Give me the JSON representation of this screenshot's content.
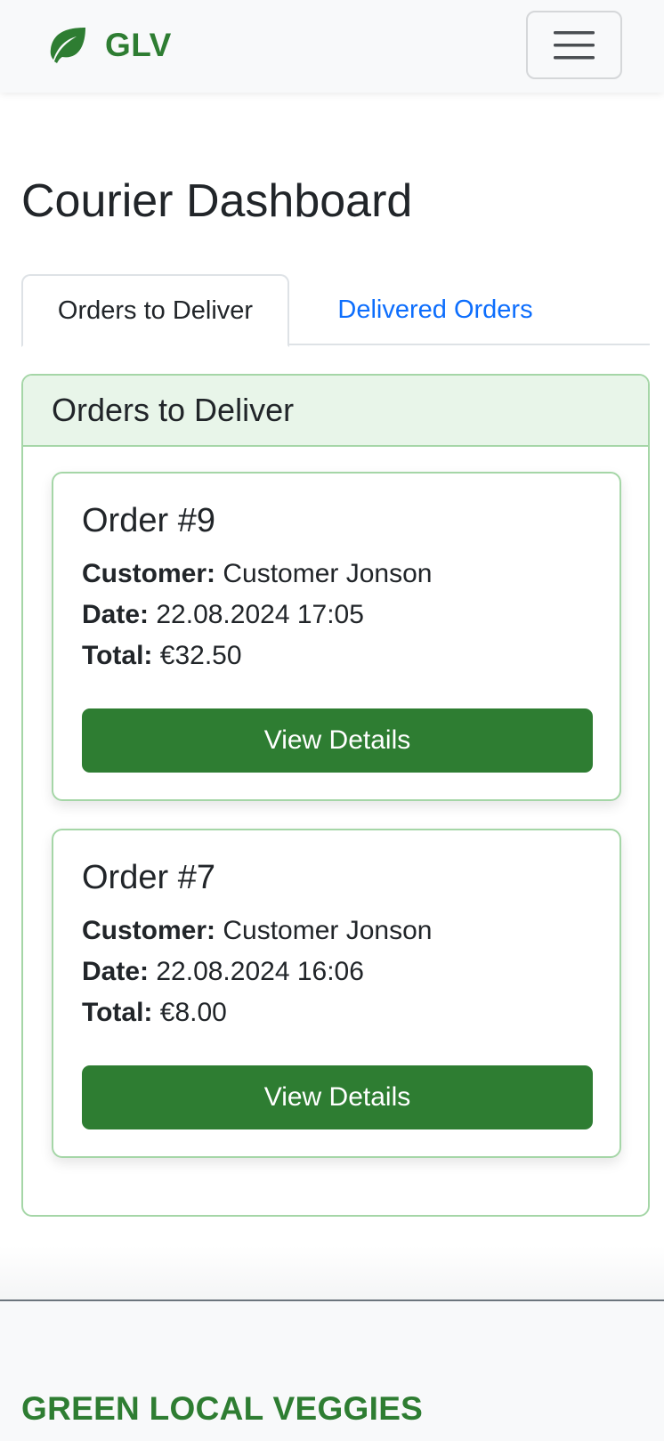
{
  "navbar": {
    "brand_text": "GLV",
    "brand_icon": "leaf-icon",
    "toggler_icon": "hamburger-icon"
  },
  "page": {
    "title": "Courier Dashboard"
  },
  "tabs": [
    {
      "label": "Orders to Deliver",
      "active": true
    },
    {
      "label": "Delivered Orders",
      "active": false
    }
  ],
  "panel": {
    "header": "Orders to Deliver",
    "orders": [
      {
        "title": "Order #9",
        "customer_label": "Customer:",
        "customer": "Customer Jonson",
        "date_label": "Date:",
        "date": "22.08.2024 17:05",
        "total_label": "Total:",
        "total": "€32.50",
        "button": "View Details"
      },
      {
        "title": "Order #7",
        "customer_label": "Customer:",
        "customer": "Customer Jonson",
        "date_label": "Date:",
        "date": "22.08.2024 16:06",
        "total_label": "Total:",
        "total": "€8.00",
        "button": "View Details"
      }
    ]
  },
  "footer": {
    "title": "GREEN LOCAL VEGGIES"
  },
  "colors": {
    "brand_green": "#2e7d32",
    "link_blue": "#0d6efd",
    "card_border": "#a5d6a7",
    "panel_header_bg": "#e8f5e9"
  }
}
